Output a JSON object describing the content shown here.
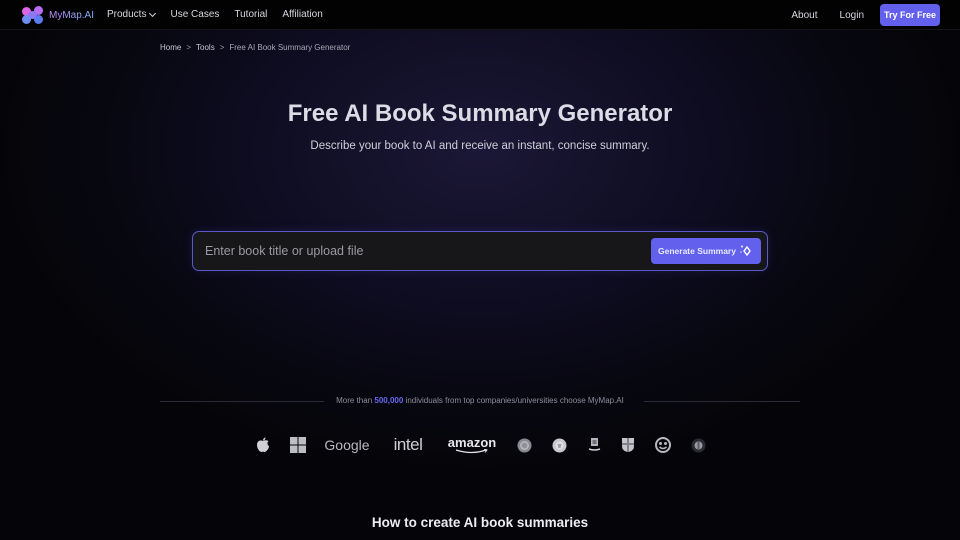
{
  "nav": {
    "logo_text": "MyMap.AI",
    "links": [
      {
        "label": "Products",
        "has_dropdown": true
      },
      {
        "label": "Use Cases"
      },
      {
        "label": "Tutorial"
      },
      {
        "label": "Affiliation"
      }
    ],
    "about": "About",
    "login": "Login",
    "cta": "Try For Free"
  },
  "breadcrumb": {
    "items": [
      "Home",
      "Tools",
      "Free AI Book Summary Generator"
    ],
    "separator": ">"
  },
  "hero": {
    "title": "Free AI Book Summary Generator",
    "subtitle": "Describe your book to AI and receive an instant, concise summary."
  },
  "search": {
    "placeholder": "Enter book title or upload file",
    "value": "",
    "button_label": "Generate Summary",
    "button_icon": "sparkle-icon"
  },
  "trust": {
    "prefix": "More than",
    "count": "500,000",
    "suffix": "individuals from top companies/universities choose MyMap.AI",
    "logos": [
      "apple-logo",
      "microsoft-logo",
      "Google",
      "intel",
      "amazon",
      "university-seal-1",
      "university-seal-2",
      "university-crest-3",
      "university-crest-4",
      "university-seal-5",
      "university-seal-6"
    ]
  },
  "section": {
    "how_title": "How to create AI book summaries"
  },
  "colors": {
    "accent": "#6360ee",
    "highlight": "#6a66f0",
    "background": "#050509"
  }
}
